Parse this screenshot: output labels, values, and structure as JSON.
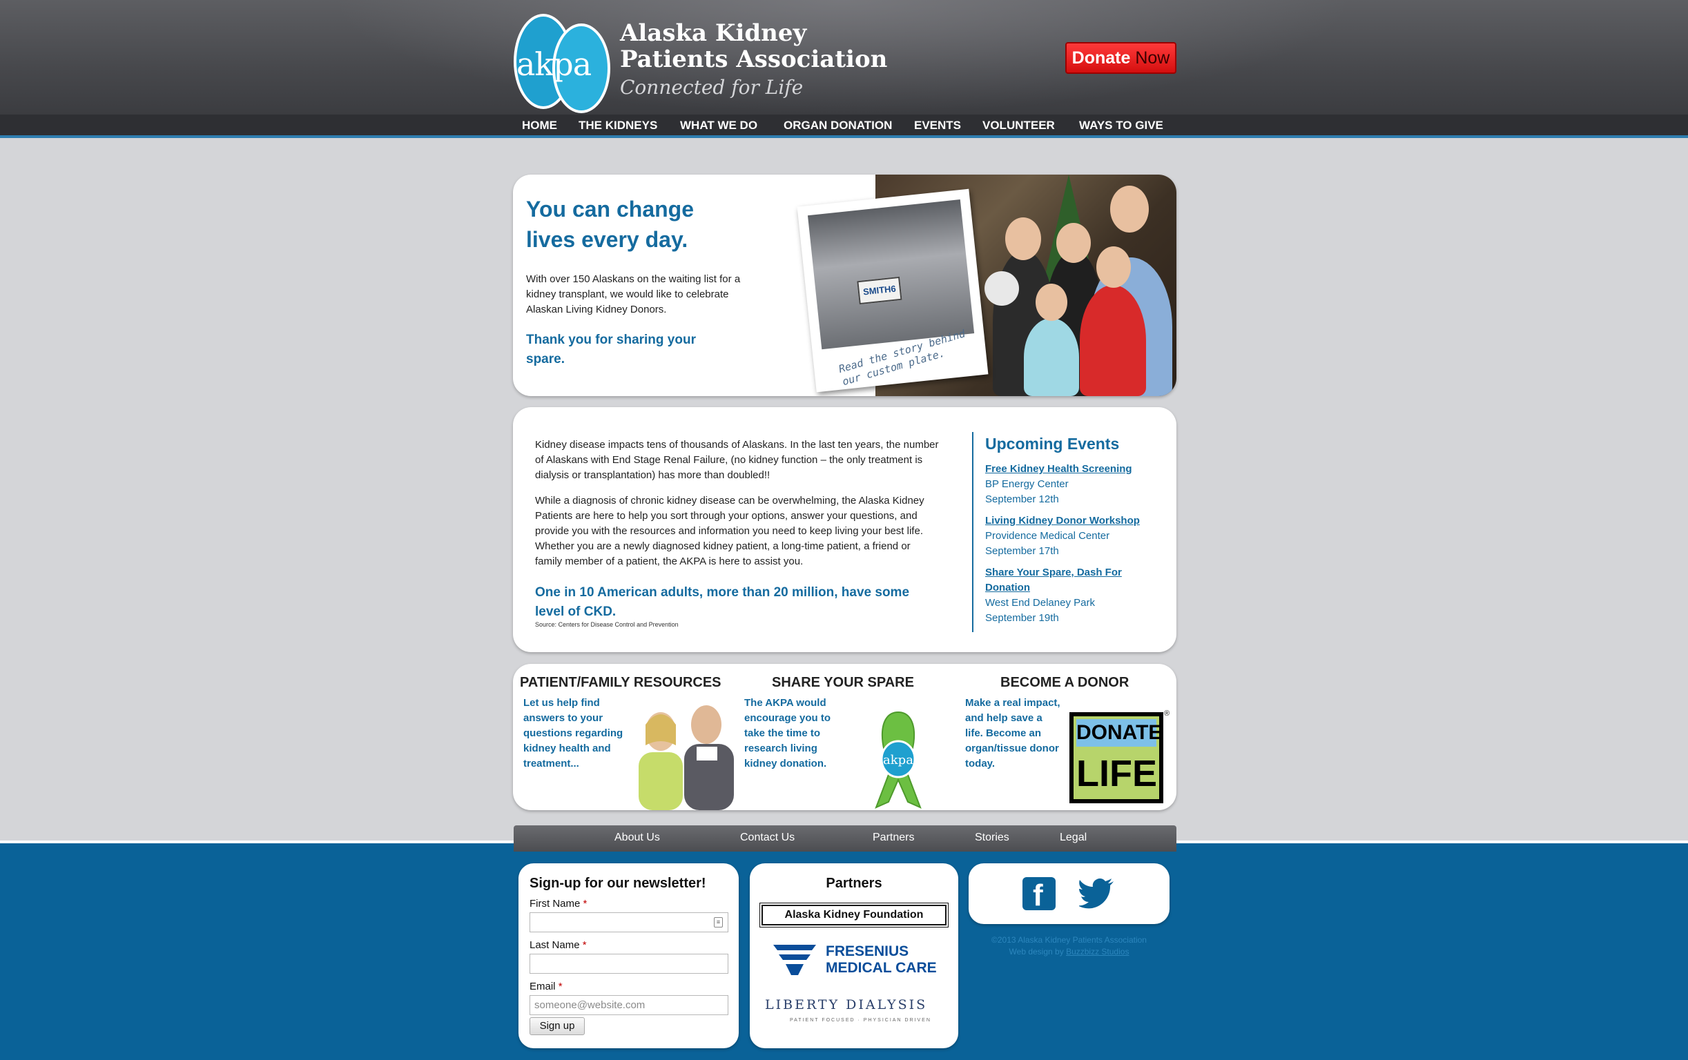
{
  "header": {
    "logo_mark": "akpa",
    "org_line1": "Alaska Kidney",
    "org_line2": "Patients Association",
    "tagline": "Connected for Life",
    "donate_part1": "Donate",
    "donate_part2": "Now"
  },
  "nav": {
    "items": [
      "HOME",
      "THE KIDNEYS",
      "WHAT WE DO",
      "ORGAN DONATION",
      "EVENTS",
      "VOLUNTEER",
      "WAYS TO GIVE"
    ]
  },
  "hero": {
    "headline": "You can change lives every day.",
    "body": "With over 150 Alaskans on the waiting list for a kidney transplant, we would like to celebrate Alaskan Living Kidney Donors.",
    "thanks": "Thank you for sharing your spare.",
    "plate_text": "SMITH6",
    "polaroid_caption": "Read the story behind our custom plate."
  },
  "info": {
    "p1": "Kidney disease impacts tens of thousands of Alaskans. In the last ten years, the number of Alaskans with End Stage Renal Failure, (no kidney function – the only treatment is dialysis or transplantation) has more than doubled!!",
    "p2": "While a diagnosis of chronic kidney disease can be overwhelming, the Alaska Kidney Patients are here to help you sort through your options, answer your questions, and provide you with the resources and information you need to keep living your best life. Whether you are a newly diagnosed kidney patient, a long-time patient, a friend or family member of a patient, the AKPA is here to assist you.",
    "stat": "One in 10 American adults, more than 20 million, have some level of CKD.",
    "source": "Source: Centers for Disease Control and Prevention"
  },
  "events": {
    "title": "Upcoming Events",
    "items": [
      {
        "name": "Free Kidney Health Screening",
        "place": "BP Energy Center",
        "date": "September 12th"
      },
      {
        "name": "Living Kidney Donor Workshop",
        "place": "Providence Medical Center",
        "date": "September 17th"
      },
      {
        "name": "Share Your Spare, Dash For Donation",
        "place": "West End Delaney Park",
        "date": "September 19th"
      }
    ]
  },
  "features": {
    "resources": {
      "heading": "PATIENT/FAMILY RESOURCES",
      "text": "Let us help find answers to your questions regarding kidney health and treatment..."
    },
    "spare": {
      "heading": "SHARE YOUR SPARE",
      "text": "The AKPA would encourage you to take the time to research living kidney donation.",
      "ribbon_text": "akpa"
    },
    "donor": {
      "heading": "BECOME A DONOR",
      "text": "Make a real impact, and help save a life. Become an organ/tissue donor today.",
      "logo_line1": "DONATE",
      "logo_line2": "LIFE",
      "reg": "®"
    }
  },
  "footer_nav": {
    "items": [
      "About Us",
      "Contact Us",
      "Partners",
      "Stories",
      "Legal"
    ]
  },
  "newsletter": {
    "title": "Sign-up for our newsletter!",
    "first_name_label": "First Name",
    "last_name_label": "Last Name",
    "email_label": "Email",
    "required_mark": "*",
    "email_placeholder": "someone@website.com",
    "submit_label": "Sign up"
  },
  "partners": {
    "title": "Partners",
    "akf": "Alaska Kidney Foundation",
    "fresenius_line1": "FRESENIUS",
    "fresenius_line2": "MEDICAL CARE",
    "liberty": "LIBERTY DIALYSIS",
    "liberty_sub": "PATIENT FOCUSED · PHYSICIAN DRIVEN"
  },
  "social": {
    "facebook_glyph": "f"
  },
  "copyright": {
    "line1": "©2013 Alaska Kidney Patients Association",
    "line2_prefix": "Web design by",
    "designer": "Buzzbizz Studios"
  },
  "colors": {
    "brand_blue": "#156b9f",
    "footer_blue": "#0a6298",
    "donate_red": "#e81818"
  }
}
